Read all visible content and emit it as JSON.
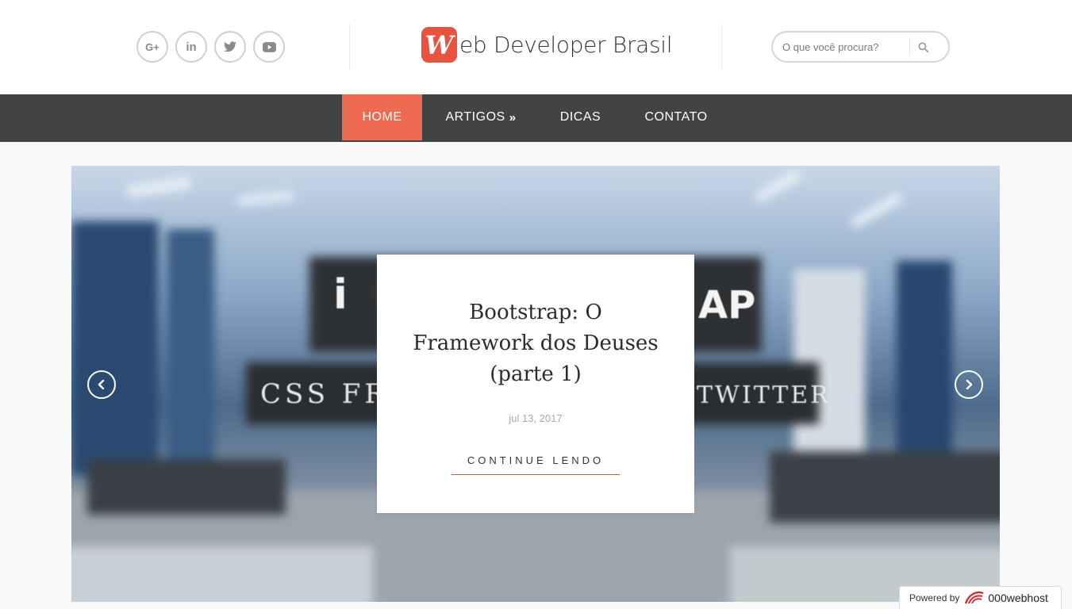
{
  "header": {
    "social": [
      {
        "name": "google-plus",
        "icon": "google-plus-icon",
        "glyph": "G+"
      },
      {
        "name": "linkedin",
        "icon": "linkedin-icon",
        "glyph": "in"
      },
      {
        "name": "twitter",
        "icon": "twitter-icon"
      },
      {
        "name": "youtube",
        "icon": "youtube-icon"
      }
    ],
    "logo": {
      "badge": "W",
      "text": "eb Developer Brasil"
    },
    "search": {
      "placeholder": "O que você procura?"
    }
  },
  "nav": {
    "items": [
      {
        "label": "HOME",
        "active": true
      },
      {
        "label": "ARTIGOS",
        "has_submenu": true,
        "submenu_glyph": "»"
      },
      {
        "label": "DICAS"
      },
      {
        "label": "CONTATO"
      }
    ]
  },
  "slider": {
    "background_text": {
      "line1_left": "i",
      "line1_right": "AP",
      "line2_left": "CSS FRA",
      "line2_right": "TWITTER"
    },
    "card": {
      "title": "Bootstrap: O Framework dos Deuses (parte 1)",
      "date": "jul 13, 2017",
      "cta": "CONTINUE LENDO"
    }
  },
  "footer_badge": {
    "label": "Powered by",
    "host": "000webhost"
  },
  "colors": {
    "accent": "#ee6a50",
    "nav_bg": "#434343",
    "logo": "#e8523e"
  }
}
